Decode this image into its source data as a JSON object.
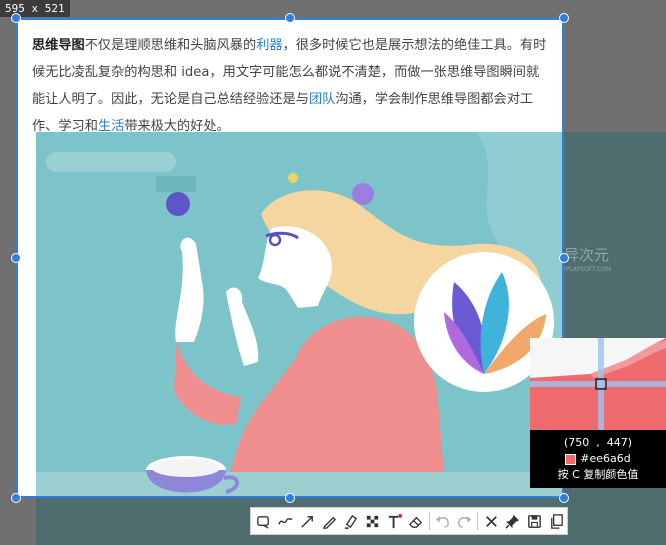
{
  "size_badge": "595 x 521",
  "article": {
    "bold_lead": "思维导图",
    "text_1": "不仅是理顺思维和头脑风暴的",
    "link_1": "利器",
    "text_2": "，很多时候它也是展示想法的绝佳工具。有时候无比凌乱复杂的构思和 idea，用文字可能怎么都说不清楚，而做一张思维导图瞬间就能让人明了。因此，无论是自己总结经验还是与",
    "link_2": "团队",
    "text_3": "沟通，学会制作思维导图都会对工作、学习和",
    "link_3": "生活",
    "text_4": "带来极大的好处。"
  },
  "watermark": {
    "name": "异次元",
    "sub": "IPLAYSOFT.COM"
  },
  "magnifier": {
    "coords_x": "750",
    "coords_sep": ",",
    "coords_y": "447",
    "coords_open": "(",
    "coords_close": ")",
    "color_hex": "#ee6a6d",
    "hint": "按 C 复制颜色值"
  },
  "toolbar": {
    "tools": [
      "rectangle-icon",
      "freehand-icon",
      "arrow-icon",
      "pen-icon",
      "highlighter-icon",
      "mosaic-icon",
      "text-icon",
      "eraser-icon",
      "undo-icon",
      "redo-icon",
      "close-icon",
      "pin-icon",
      "save-icon",
      "copy-icon"
    ]
  },
  "colors": {
    "selection_border": "#2f7fe0",
    "illustration_bg": "#7cc4c9",
    "shirt": "#ee8e8e",
    "hair": "#f5d6a0",
    "picked": "#ee6a6d"
  }
}
